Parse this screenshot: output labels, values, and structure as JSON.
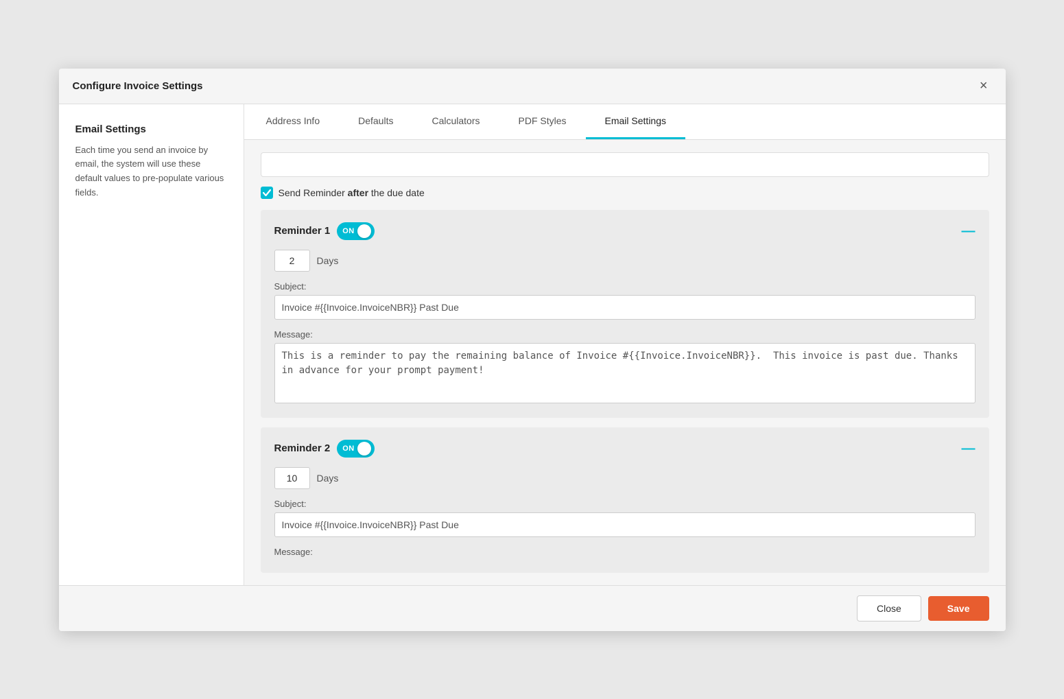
{
  "modal": {
    "title": "Configure Invoice Settings",
    "close_label": "×"
  },
  "tabs": {
    "items": [
      {
        "label": "Address Info",
        "active": false
      },
      {
        "label": "Defaults",
        "active": false
      },
      {
        "label": "Calculators",
        "active": false
      },
      {
        "label": "PDF Styles",
        "active": false
      },
      {
        "label": "Email Settings",
        "active": true
      }
    ]
  },
  "sidebar": {
    "title": "Email Settings",
    "description": "Each time you send an invoice by email, the system will use these default values to pre-populate various fields."
  },
  "reminder_checkbox": {
    "label_before": "Send Reminder ",
    "label_bold": "after",
    "label_after": " the due date"
  },
  "reminder1": {
    "title": "Reminder 1",
    "toggle_label": "ON",
    "days_value": "2",
    "days_unit": "Days",
    "subject_label": "Subject:",
    "subject_value": "Invoice #{{Invoice.InvoiceNBR}} Past Due",
    "message_label": "Message:",
    "message_value": "This is a reminder to pay the remaining balance of Invoice #{{Invoice.InvoiceNBR}}.  This invoice is past due. Thanks in advance for your prompt payment!"
  },
  "reminder2": {
    "title": "Reminder 2",
    "toggle_label": "ON",
    "days_value": "10",
    "days_unit": "Days",
    "subject_label": "Subject:",
    "subject_value": "Invoice #{{Invoice.InvoiceNBR}} Past Due",
    "message_label": "Message:"
  },
  "footer": {
    "close_label": "Close",
    "save_label": "Save"
  }
}
